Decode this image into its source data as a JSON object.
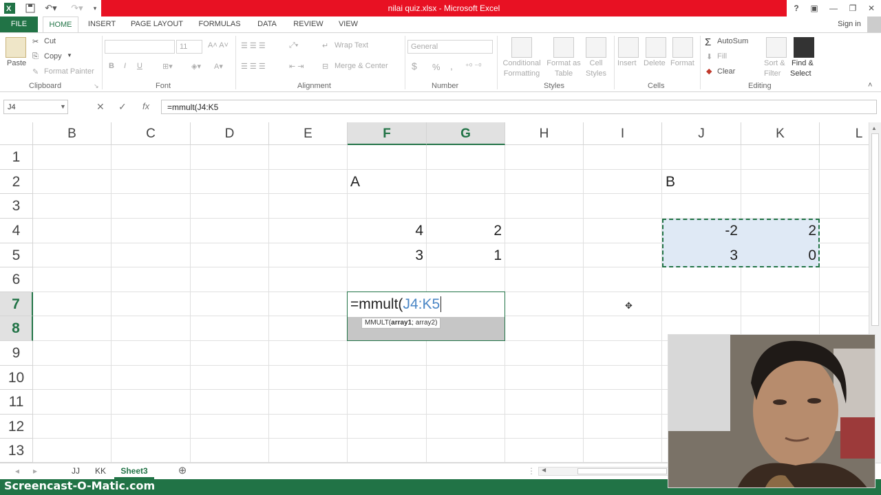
{
  "window": {
    "title": "nilai quiz.xlsx - Microsoft Excel",
    "help": "?",
    "sign_in": "Sign in"
  },
  "tabs": [
    "FILE",
    "HOME",
    "INSERT",
    "PAGE LAYOUT",
    "FORMULAS",
    "DATA",
    "REVIEW",
    "VIEW"
  ],
  "ribbon": {
    "clipboard": {
      "paste": "Paste",
      "cut": "Cut",
      "copy": "Copy",
      "format_painter": "Format Painter",
      "label": "Clipboard"
    },
    "font": {
      "size": "11",
      "bold": "B",
      "italic": "I",
      "underline": "U",
      "label": "Font"
    },
    "alignment": {
      "wrap_text": "Wrap Text",
      "merge_center": "Merge & Center",
      "label": "Alignment"
    },
    "number": {
      "format": "General",
      "currency": "$",
      "percent": "%",
      "comma": ",",
      "label": "Number"
    },
    "styles": {
      "conditional": "Conditional",
      "conditional2": "Formatting",
      "format_as": "Format as",
      "format_as2": "Table",
      "cell": "Cell",
      "cell2": "Styles",
      "label": "Styles"
    },
    "cells": {
      "insert": "Insert",
      "delete": "Delete",
      "format": "Format",
      "label": "Cells"
    },
    "editing": {
      "autosum": "AutoSum",
      "fill": "Fill",
      "clear": "Clear",
      "sort": "Sort &",
      "sort2": "Filter",
      "find": "Find &",
      "find2": "Select",
      "label": "Editing"
    }
  },
  "formula_bar": {
    "name_box": "J4",
    "cancel": "✕",
    "enter": "✓",
    "fx": "fx",
    "formula": "=mmult(J4:K5"
  },
  "columns": [
    "B",
    "C",
    "D",
    "E",
    "F",
    "G",
    "H",
    "I",
    "J",
    "K",
    "L"
  ],
  "rows": [
    "1",
    "2",
    "3",
    "4",
    "5",
    "6",
    "7",
    "8",
    "9",
    "10",
    "11",
    "12",
    "13"
  ],
  "cells": {
    "F2": "A",
    "J2": "B",
    "F4": "4",
    "G4": "2",
    "F5": "3",
    "G5": "1",
    "J4": "-2",
    "K4": "2",
    "J5": "3",
    "K5": "0"
  },
  "edit": {
    "prefix": "=mmult(",
    "ref": "J4:K5",
    "tooltip_fn": "MMULT(",
    "tooltip_arg1": "array1",
    "tooltip_rest": "; array2)"
  },
  "sheets": [
    "JJ",
    "KK",
    "Sheet3"
  ],
  "watermark": "Screencast-O-Matic.com",
  "colors": {
    "excel_green": "#217346",
    "title_red": "#e81123",
    "ref_blue": "#4a86c5"
  }
}
